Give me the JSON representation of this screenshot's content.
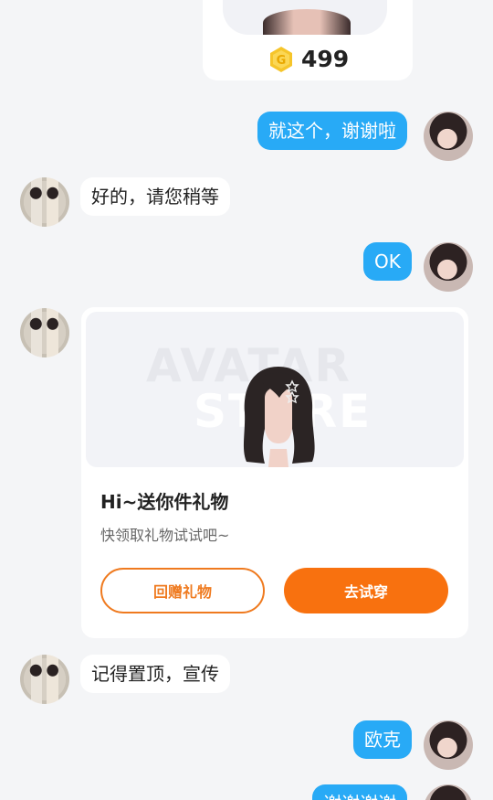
{
  "previous_item": {
    "coin_icon": "gold-g-coin-icon",
    "price": "499",
    "accent": "#f6c52a"
  },
  "messages": [
    {
      "side": "me",
      "text": "就这个，谢谢啦"
    },
    {
      "side": "them",
      "text": "好的，请您稍等"
    },
    {
      "side": "me",
      "text": "OK"
    },
    {
      "side": "them",
      "type": "gift_card"
    },
    {
      "side": "them",
      "text": "记得置顶，宣传"
    },
    {
      "side": "me",
      "text": "欧克"
    },
    {
      "side": "me",
      "text": "谢谢谢谢"
    }
  ],
  "gift_card": {
    "watermark_line1": "AVATAR",
    "watermark_line2": "STORE",
    "title": "Hi~送你件礼物",
    "subtitle": "快领取礼物试试吧~",
    "return_gift_label": "回赠礼物",
    "try_on_label": "去试穿"
  },
  "colors": {
    "my_bubble": "#28aaf6",
    "their_bubble": "#ffffff",
    "primary_button": "#f8710f",
    "outline_button": "#ef7a1f",
    "background": "#f4f5f7"
  }
}
